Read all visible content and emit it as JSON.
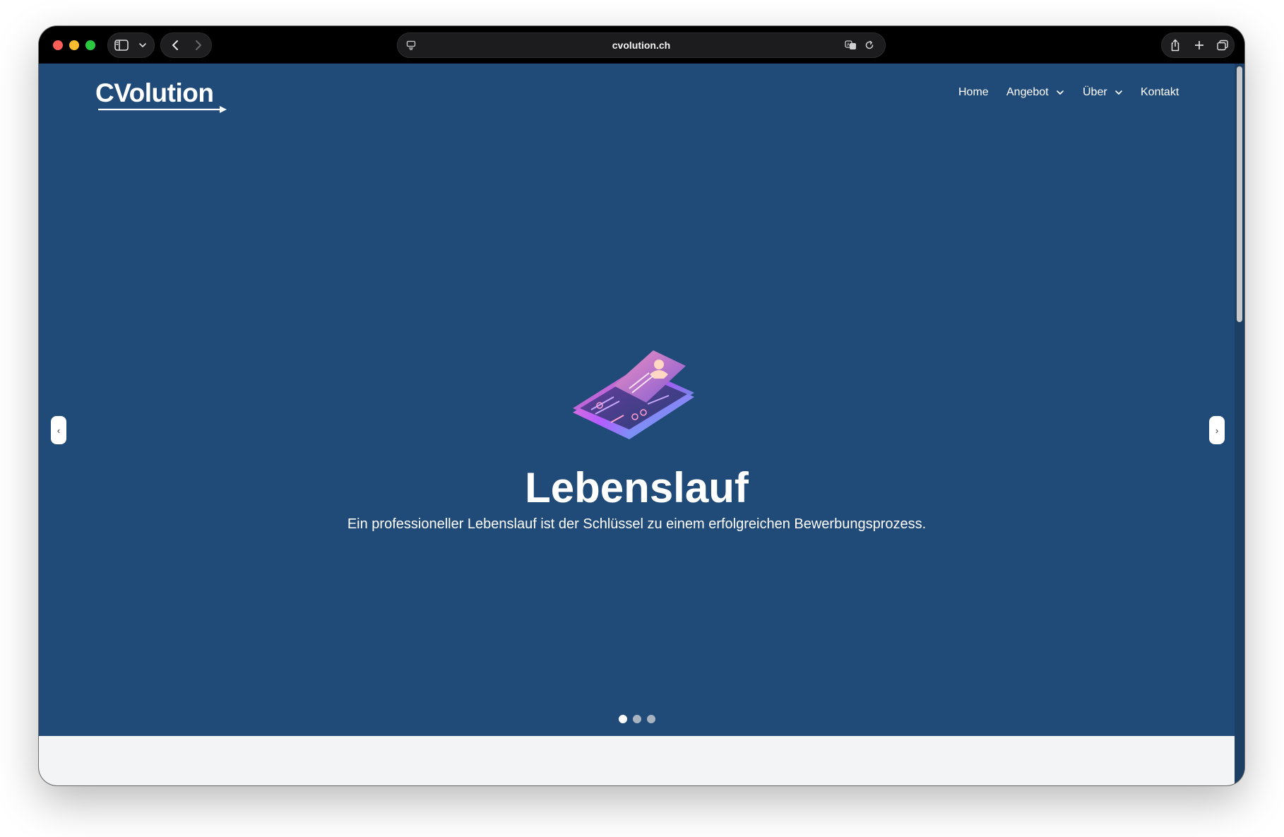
{
  "browser": {
    "url": "cvolution.ch",
    "icons": [
      "sidebar-icon",
      "chevron-down-icon",
      "back-icon",
      "forward-icon",
      "page-menu-icon",
      "translate-icon",
      "reload-icon",
      "share-icon",
      "new-tab-icon",
      "tabs-overview-icon"
    ]
  },
  "site": {
    "logo_text": "CVolution",
    "nav": {
      "home": "Home",
      "angebot": "Angebot",
      "ueber": "Über",
      "kontakt": "Kontakt"
    }
  },
  "hero": {
    "title": "Lebenslauf",
    "subtitle": "Ein professioneller Lebenslauf ist der Schlüssel zu einem erfolgreichen Bewerbungsprozess.",
    "prev_label": "‹",
    "next_label": "›",
    "slide_count": 3,
    "active_slide": 1,
    "background_color": "#204a78"
  }
}
